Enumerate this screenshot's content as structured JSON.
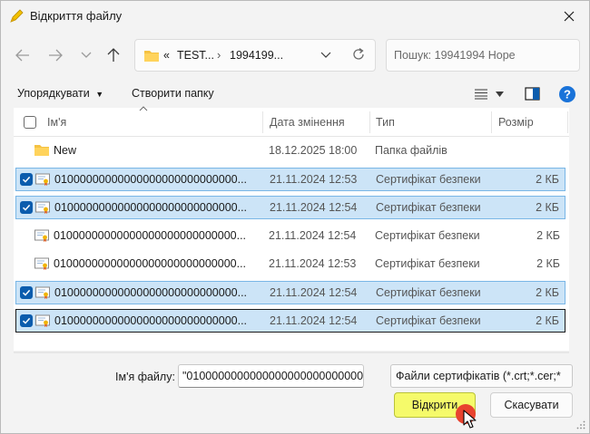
{
  "window": {
    "title": "Відкриття файлу"
  },
  "nav": {
    "address_overflow": "«",
    "address_crumbs": [
      "TEST...",
      "1994199..."
    ],
    "search_placeholder": "Пошук: 19941994 Hope"
  },
  "toolbar": {
    "organize_label": "Упорядкувати",
    "new_folder_label": "Створити папку"
  },
  "list": {
    "columns": {
      "name": "Ім'я",
      "date": "Дата змінення",
      "type": "Тип",
      "size": "Розмір"
    },
    "rows": [
      {
        "name": "New",
        "date": "18.12.2025 18:00",
        "type": "Папка файлів",
        "size": "",
        "kind": "folder",
        "selected": false
      },
      {
        "name": "01000000000000000000000000000...",
        "date": "21.11.2024 12:53",
        "type": "Сертифікат безпеки",
        "size": "2 КБ",
        "kind": "cert",
        "selected": true
      },
      {
        "name": "01000000000000000000000000000...",
        "date": "21.11.2024 12:54",
        "type": "Сертифікат безпеки",
        "size": "2 КБ",
        "kind": "cert",
        "selected": true
      },
      {
        "name": "01000000000000000000000000000...",
        "date": "21.11.2024 12:54",
        "type": "Сертифікат безпеки",
        "size": "2 КБ",
        "kind": "cert",
        "selected": false
      },
      {
        "name": "01000000000000000000000000000...",
        "date": "21.11.2024 12:53",
        "type": "Сертифікат безпеки",
        "size": "2 КБ",
        "kind": "cert",
        "selected": false
      },
      {
        "name": "01000000000000000000000000000...",
        "date": "21.11.2024 12:54",
        "type": "Сертифікат безпеки",
        "size": "2 КБ",
        "kind": "cert",
        "selected": true
      },
      {
        "name": "01000000000000000000000000000...",
        "date": "21.11.2024 12:54",
        "type": "Сертифікат безпеки",
        "size": "2 КБ",
        "kind": "cert",
        "selected": true,
        "focused": true
      }
    ]
  },
  "footer": {
    "filename_label": "Ім'я файлу:",
    "filename_value": "\"0100000000000000000000000000000",
    "filter_value": "Файли сертифікатів (*.crt;*.cer;*",
    "open_label": "Відкрити",
    "cancel_label": "Скасувати"
  },
  "colors": {
    "accent": "#0b5cad",
    "selection": "#cce4f7",
    "open_button": "#f5fa6a",
    "cursor": "#e8432f"
  }
}
